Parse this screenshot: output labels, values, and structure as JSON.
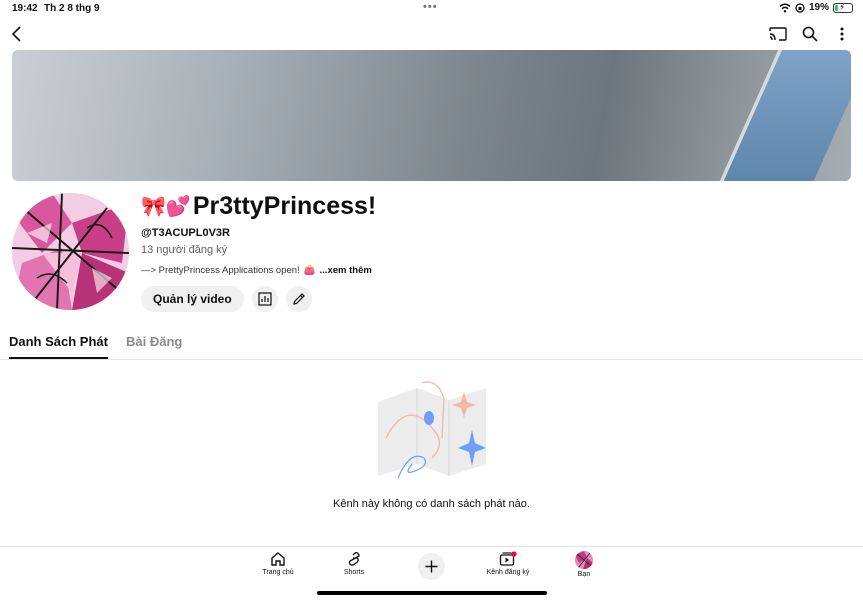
{
  "status": {
    "time": "19:42",
    "date": "Th 2 8 thg 9",
    "battery": "19%",
    "battery_level": 0.19,
    "multitask_dots": "•••"
  },
  "top_nav": {
    "back_icon": "chevron-left-icon",
    "cast_icon": "cast-icon",
    "search_icon": "search-icon",
    "more_icon": "more-vertical-icon"
  },
  "channel": {
    "emoji": "🎀💕",
    "name": "Pr3ttyPrincess!",
    "handle": "@T3ACUPL0V3R",
    "subscribers": "13 người đăng ký",
    "description": "—> PrettyPrincess Applications open!",
    "description_emoji": "👛",
    "more_link": "...xem thêm",
    "manage_button": "Quản lý video"
  },
  "tabs": [
    {
      "label": "Danh Sách Phát",
      "active": true
    },
    {
      "label": "Bài Đăng",
      "active": false
    }
  ],
  "empty_state": {
    "message": "Kênh này không có danh sách phát nào."
  },
  "bottom_nav": {
    "home": "Trang chủ",
    "shorts": "Shorts",
    "subscriptions": "Kênh đăng ký",
    "you": "Bạn"
  },
  "colors": {
    "accent_red": "#ff0033",
    "text_primary": "#0f0f0f",
    "text_secondary": "#606060",
    "chip_bg": "#f0f0f0"
  }
}
